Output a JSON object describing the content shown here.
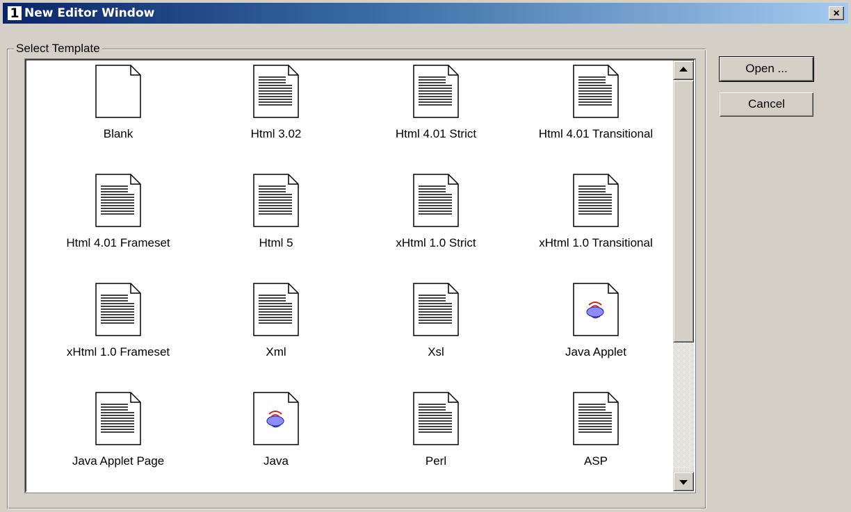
{
  "window": {
    "title": "New Editor Window",
    "icon_text": "1",
    "close_symbol": "×"
  },
  "group": {
    "label": "Select Template"
  },
  "buttons": {
    "open": "Open ...",
    "cancel": "Cancel"
  },
  "templates": [
    {
      "label": "Blank",
      "icon": "blank-document-icon"
    },
    {
      "label": "Html 3.02",
      "icon": "text-document-icon"
    },
    {
      "label": "Html 4.01 Strict",
      "icon": "text-document-icon"
    },
    {
      "label": "Html 4.01 Transitional",
      "icon": "text-document-icon"
    },
    {
      "label": "Html 4.01 Frameset",
      "icon": "text-document-icon"
    },
    {
      "label": "Html 5",
      "icon": "text-document-icon"
    },
    {
      "label": "xHtml 1.0 Strict",
      "icon": "text-document-icon"
    },
    {
      "label": "xHtml 1.0 Transitional",
      "icon": "text-document-icon"
    },
    {
      "label": "xHtml 1.0 Frameset",
      "icon": "text-document-icon"
    },
    {
      "label": "Xml",
      "icon": "text-document-icon"
    },
    {
      "label": "Xsl",
      "icon": "text-document-icon"
    },
    {
      "label": "Java Applet",
      "icon": "java-document-icon"
    },
    {
      "label": "Java Applet Page",
      "icon": "text-document-icon"
    },
    {
      "label": "Java",
      "icon": "java-document-icon"
    },
    {
      "label": "Perl",
      "icon": "text-document-icon"
    },
    {
      "label": "ASP",
      "icon": "text-document-icon"
    }
  ],
  "colors": {
    "title_start": "#0a246a",
    "title_end": "#a6caf0",
    "face": "#d4d0c8"
  }
}
